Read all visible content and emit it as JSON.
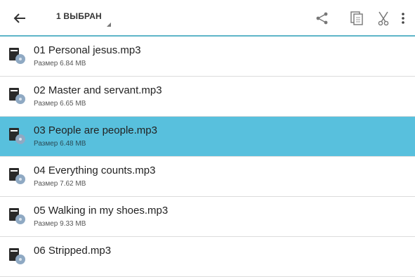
{
  "toolbar": {
    "back_icon": "arrow-left-icon",
    "selection_label": "1 ВЫБРАН",
    "actions": [
      {
        "name": "share-icon"
      },
      {
        "name": "copy-icon"
      },
      {
        "name": "cut-icon"
      },
      {
        "name": "more-vert-icon"
      }
    ]
  },
  "colors": {
    "accent": "#5fb5c8",
    "selected_row": "#58c0dd"
  },
  "files": [
    {
      "name": "01 Personal jesus.mp3",
      "size": "Размер 6.84 MB",
      "selected": false
    },
    {
      "name": "02 Master and servant.mp3",
      "size": "Размер 6.65 MB",
      "selected": false
    },
    {
      "name": "03 People are people.mp3",
      "size": "Размер 6.48 MB",
      "selected": true
    },
    {
      "name": "04 Everything counts.mp3",
      "size": "Размер 7.62 MB",
      "selected": false
    },
    {
      "name": "05 Walking in my shoes.mp3",
      "size": "Размер 9.33 MB",
      "selected": false
    },
    {
      "name": "06 Stripped.mp3",
      "size": "",
      "selected": false
    }
  ]
}
